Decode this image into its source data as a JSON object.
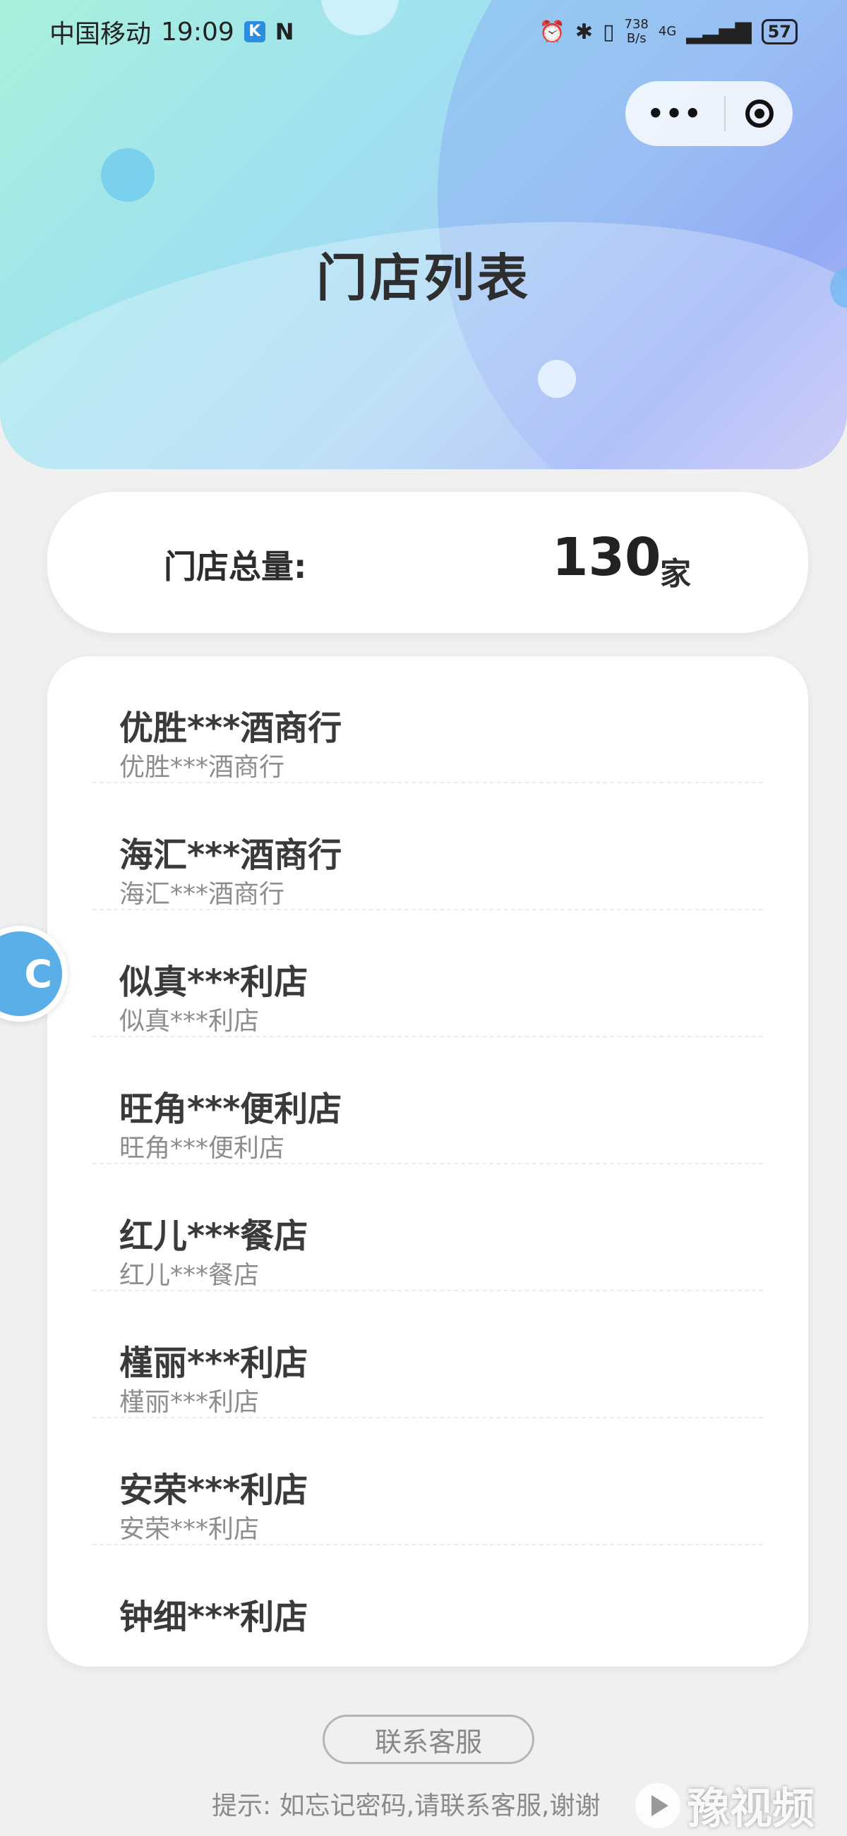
{
  "status_bar": {
    "carrier": "中国移动",
    "time": "19:09",
    "net_speed_value": "738",
    "net_speed_unit": "B/s",
    "network": "4G",
    "battery": "57"
  },
  "header": {
    "title": "门店列表"
  },
  "summary": {
    "label": "门店总量:",
    "count": "130",
    "unit": "家"
  },
  "stores": [
    {
      "name": "优胜***酒商行",
      "sub": "优胜***酒商行"
    },
    {
      "name": "海汇***酒商行",
      "sub": "海汇***酒商行"
    },
    {
      "name": "似真***利店",
      "sub": "似真***利店"
    },
    {
      "name": "旺角***便利店",
      "sub": "旺角***便利店"
    },
    {
      "name": "红儿***餐店",
      "sub": "红儿***餐店"
    },
    {
      "name": "槿丽***利店",
      "sub": "槿丽***利店"
    },
    {
      "name": "安荣***利店",
      "sub": "安荣***利店"
    },
    {
      "name": "钟细***利店",
      "sub": ""
    }
  ],
  "footer": {
    "contact_label": "联系客服",
    "hint": "提示: 如忘记密码,请联系客服,谢谢"
  },
  "watermark": {
    "text": "豫视频"
  }
}
